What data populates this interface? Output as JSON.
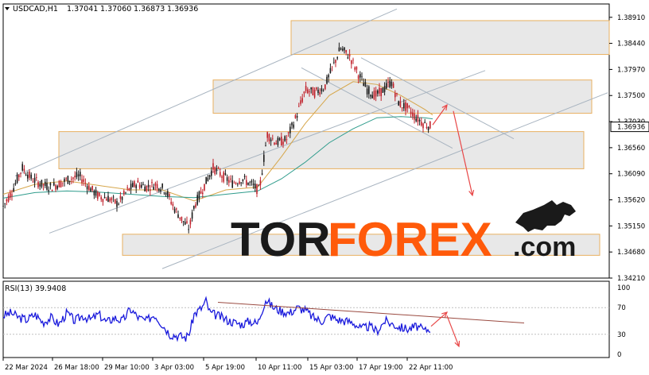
{
  "header": {
    "symbol": "USDCAD,H1",
    "open": "1.37041",
    "high": "1.37060",
    "low": "1.36873",
    "close": "1.36936"
  },
  "rsi_label": "RSI(13) 39.9408",
  "watermark": {
    "left": "TOR",
    "right": "FOREX",
    "suffix": ".com"
  },
  "colors": {
    "bull_candle": "#1a1a1a",
    "bear_candle": "#c0202a",
    "ma_fast": "#d6a64a",
    "ma_slow": "#2f9c8c",
    "zone_fill": "#e4e4e4",
    "zone_border": "#e8b060",
    "trendline": "#a8b4c0",
    "arrow": "#e84848",
    "rsi_line": "#1a1adc",
    "rsi_trend": "#9a4a40",
    "brand_orange": "#ff5a0a",
    "brand_dark": "#1a1a1a"
  },
  "chart_data": {
    "type": "line",
    "price_axis": {
      "ticks": [
        "1.38910",
        "1.38440",
        "1.37970",
        "1.37500",
        "1.37030",
        "1.36560",
        "1.36090",
        "1.35620",
        "1.35150",
        "1.34680",
        "1.34210"
      ],
      "range": [
        1.3421,
        1.3915
      ],
      "current_price_label": "1.36936"
    },
    "time_axis": {
      "ticks": [
        "22 Mar 2024",
        "26 Mar 18:00",
        "29 Mar 10:00",
        "3 Apr 03:00",
        "5 Apr 19:00",
        "10 Apr 11:00",
        "15 Apr 03:00",
        "17 Apr 19:00",
        "22 Apr 11:00"
      ]
    },
    "price_series": {
      "name": "",
      "points": [
        [
          0,
          1.355
        ],
        [
          12,
          1.358
        ],
        [
          24,
          1.362
        ],
        [
          36,
          1.36
        ],
        [
          48,
          1.359
        ],
        [
          60,
          1.3585
        ],
        [
          72,
          1.3592
        ],
        [
          84,
          1.36
        ],
        [
          96,
          1.3605
        ],
        [
          108,
          1.3585
        ],
        [
          120,
          1.3568
        ],
        [
          132,
          1.3565
        ],
        [
          144,
          1.3555
        ],
        [
          156,
          1.3578
        ],
        [
          168,
          1.3592
        ],
        [
          180,
          1.3585
        ],
        [
          192,
          1.359
        ],
        [
          204,
          1.358
        ],
        [
          216,
          1.3545
        ],
        [
          228,
          1.352
        ],
        [
          234,
          1.351
        ],
        [
          240,
          1.355
        ],
        [
          252,
          1.3585
        ],
        [
          264,
          1.362
        ],
        [
          276,
          1.3605
        ],
        [
          288,
          1.3592
        ],
        [
          300,
          1.36
        ],
        [
          312,
          1.359
        ],
        [
          322,
          1.3578
        ],
        [
          332,
          1.368
        ],
        [
          344,
          1.3665
        ],
        [
          356,
          1.367
        ],
        [
          368,
          1.371
        ],
        [
          380,
          1.376
        ],
        [
          392,
          1.3755
        ],
        [
          404,
          1.3765
        ],
        [
          414,
          1.38
        ],
        [
          424,
          1.3835
        ],
        [
          436,
          1.382
        ],
        [
          446,
          1.379
        ],
        [
          458,
          1.376
        ],
        [
          468,
          1.375
        ],
        [
          478,
          1.376
        ],
        [
          488,
          1.3775
        ],
        [
          498,
          1.3735
        ],
        [
          508,
          1.3728
        ],
        [
          518,
          1.3712
        ],
        [
          528,
          1.37
        ],
        [
          538,
          1.3694
        ]
      ]
    },
    "ma_fast": {
      "name": "",
      "points": [
        [
          0,
          1.3572
        ],
        [
          40,
          1.359
        ],
        [
          80,
          1.3596
        ],
        [
          120,
          1.3588
        ],
        [
          160,
          1.358
        ],
        [
          200,
          1.358
        ],
        [
          240,
          1.356
        ],
        [
          280,
          1.358
        ],
        [
          320,
          1.3585
        ],
        [
          350,
          1.364
        ],
        [
          380,
          1.37
        ],
        [
          410,
          1.375
        ],
        [
          440,
          1.3775
        ],
        [
          470,
          1.377
        ],
        [
          500,
          1.375
        ],
        [
          530,
          1.3725
        ],
        [
          540,
          1.3715
        ]
      ]
    },
    "ma_slow": {
      "name": "",
      "points": [
        [
          0,
          1.3565
        ],
        [
          40,
          1.3575
        ],
        [
          80,
          1.3578
        ],
        [
          120,
          1.3576
        ],
        [
          160,
          1.3572
        ],
        [
          200,
          1.3568
        ],
        [
          240,
          1.3566
        ],
        [
          280,
          1.3572
        ],
        [
          320,
          1.3578
        ],
        [
          350,
          1.36
        ],
        [
          380,
          1.363
        ],
        [
          410,
          1.3665
        ],
        [
          440,
          1.369
        ],
        [
          470,
          1.371
        ],
        [
          500,
          1.3712
        ],
        [
          530,
          1.371
        ],
        [
          540,
          1.3708
        ]
      ]
    },
    "zones": [
      {
        "x": [
          362,
          762
        ],
        "y": [
          1.3824,
          1.3885
        ]
      },
      {
        "x": [
          264,
          740
        ],
        "y": [
          1.3718,
          1.3778
        ]
      },
      {
        "x": [
          70,
          730
        ],
        "y": [
          1.3618,
          1.3685
        ]
      },
      {
        "x": [
          150,
          750
        ],
        "y": [
          1.3462,
          1.35
        ]
      }
    ],
    "trendlines": [
      {
        "from": [
          15,
          1.3605
        ],
        "to": [
          495,
          1.3906
        ]
      },
      {
        "from": [
          58,
          1.3502
        ],
        "to": [
          606,
          1.3795
        ]
      },
      {
        "from": [
          200,
          1.3438
        ],
        "to": [
          760,
          1.3755
        ]
      },
      {
        "from": [
          375,
          1.38
        ],
        "to": [
          565,
          1.3655
        ]
      },
      {
        "from": [
          450,
          1.3818
        ],
        "to": [
          642,
          1.3672
        ]
      }
    ],
    "forecast_arrows": [
      {
        "from": [
          540,
          1.3697
        ],
        "to": [
          558,
          1.3733
        ]
      },
      {
        "from": [
          566,
          1.3722
        ],
        "to": [
          590,
          1.357
        ]
      }
    ],
    "rsi": {
      "ticks": [
        "100",
        "70",
        "30",
        "0"
      ],
      "range": [
        0,
        100
      ],
      "values": [
        [
          0,
          58
        ],
        [
          10,
          62
        ],
        [
          20,
          55
        ],
        [
          30,
          52
        ],
        [
          40,
          60
        ],
        [
          50,
          48
        ],
        [
          60,
          55
        ],
        [
          70,
          45
        ],
        [
          80,
          62
        ],
        [
          90,
          50
        ],
        [
          100,
          58
        ],
        [
          110,
          52
        ],
        [
          120,
          60
        ],
        [
          130,
          48
        ],
        [
          140,
          55
        ],
        [
          150,
          50
        ],
        [
          160,
          68
        ],
        [
          170,
          55
        ],
        [
          180,
          50
        ],
        [
          190,
          60
        ],
        [
          200,
          45
        ],
        [
          210,
          30
        ],
        [
          220,
          28
        ],
        [
          230,
          25
        ],
        [
          235,
          35
        ],
        [
          240,
          60
        ],
        [
          250,
          70
        ],
        [
          255,
          80
        ],
        [
          260,
          62
        ],
        [
          270,
          58
        ],
        [
          280,
          52
        ],
        [
          290,
          48
        ],
        [
          300,
          45
        ],
        [
          310,
          50
        ],
        [
          320,
          46
        ],
        [
          325,
          65
        ],
        [
          330,
          82
        ],
        [
          340,
          70
        ],
        [
          350,
          65
        ],
        [
          360,
          62
        ],
        [
          370,
          70
        ],
        [
          380,
          66
        ],
        [
          390,
          55
        ],
        [
          400,
          50
        ],
        [
          410,
          58
        ],
        [
          420,
          52
        ],
        [
          430,
          50
        ],
        [
          440,
          48
        ],
        [
          450,
          38
        ],
        [
          460,
          42
        ],
        [
          470,
          35
        ],
        [
          480,
          50
        ],
        [
          490,
          45
        ],
        [
          500,
          40
        ],
        [
          510,
          38
        ],
        [
          520,
          42
        ],
        [
          530,
          35
        ],
        [
          538,
          40
        ]
      ],
      "trendline": {
        "from": [
          270,
          78
        ],
        "to": [
          655,
          47
        ]
      },
      "forecast_arrows": [
        {
          "from": [
            538,
            42
          ],
          "to": [
            558,
            63
          ]
        },
        {
          "from": [
            558,
            58
          ],
          "to": [
            573,
            12
          ]
        }
      ]
    }
  }
}
